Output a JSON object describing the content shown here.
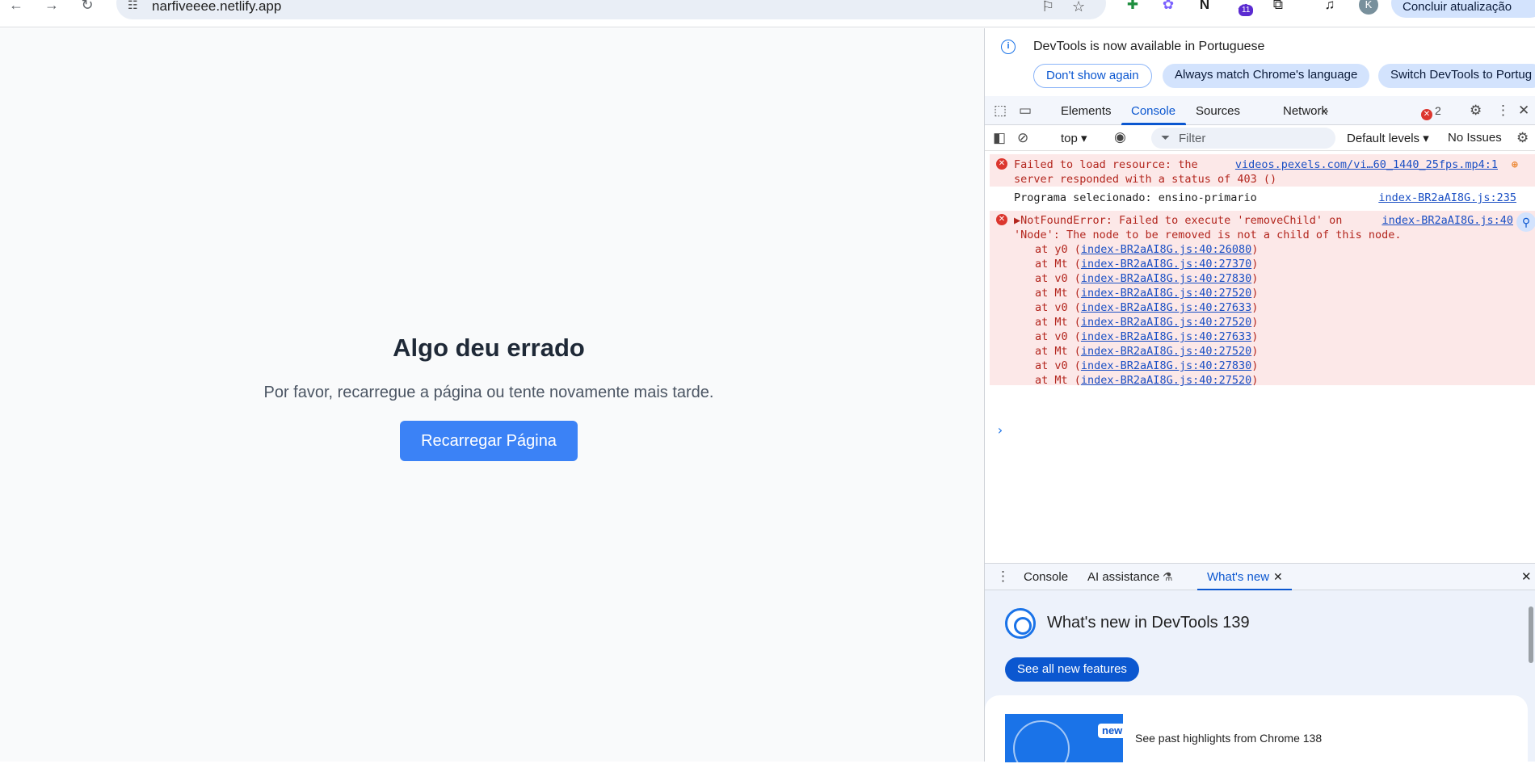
{
  "browser": {
    "url": "narfiveeee.netlify.app",
    "update_label": "Concluir atualização",
    "profile_initial": "K",
    "extension_badge": "11"
  },
  "page": {
    "title": "Algo deu errado",
    "message": "Por favor, recarregue a página ou tente novamente mais tarde.",
    "reload_label": "Recarregar Página",
    "accent": "#3b82f6"
  },
  "devtools": {
    "infobar": {
      "message": "DevTools is now available in Portuguese",
      "dont_show": "Don't show again",
      "always_match": "Always match Chrome's language",
      "switch": "Switch DevTools to Portug"
    },
    "tabs": [
      "Elements",
      "Console",
      "Sources",
      "Network"
    ],
    "error_count": "2",
    "filter": {
      "context": "top ▾",
      "placeholder": "Filter",
      "levels": "Default levels ▾",
      "issues": "No Issues"
    },
    "console": {
      "msg1": {
        "line1": "Failed to load resource: the",
        "line2": "server responded with a status of 403 ()",
        "link": "videos.pexels.com/vi…60_1440_25fps.mp4:1"
      },
      "msg2": {
        "text": "Programa selecionado: ensino-primario",
        "link": "index-BR2aAI8G.js:235"
      },
      "msg3": {
        "line1": "▶NotFoundError: Failed to execute 'removeChild' on",
        "line2": "'Node': The node to be removed is not a child of this node.",
        "link": "index-BR2aAI8G.js:40",
        "stack": [
          {
            "fn": "at y0 (",
            "loc": "index-BR2aAI8G.js:40:26080"
          },
          {
            "fn": "at Mt (",
            "loc": "index-BR2aAI8G.js:40:27370"
          },
          {
            "fn": "at v0 (",
            "loc": "index-BR2aAI8G.js:40:27830"
          },
          {
            "fn": "at Mt (",
            "loc": "index-BR2aAI8G.js:40:27520"
          },
          {
            "fn": "at v0 (",
            "loc": "index-BR2aAI8G.js:40:27633"
          },
          {
            "fn": "at Mt (",
            "loc": "index-BR2aAI8G.js:40:27520"
          },
          {
            "fn": "at v0 (",
            "loc": "index-BR2aAI8G.js:40:27633"
          },
          {
            "fn": "at Mt (",
            "loc": "index-BR2aAI8G.js:40:27520"
          },
          {
            "fn": "at v0 (",
            "loc": "index-BR2aAI8G.js:40:27830"
          },
          {
            "fn": "at Mt (",
            "loc": "index-BR2aAI8G.js:40:27520"
          }
        ]
      }
    },
    "drawer": {
      "tabs": [
        "Console",
        "AI assistance",
        "What's new"
      ],
      "whatsnew_title": "What's new in DevTools 139",
      "see_all": "See all new features",
      "badge": "new",
      "highlight": "See past highlights from Chrome 138"
    }
  }
}
